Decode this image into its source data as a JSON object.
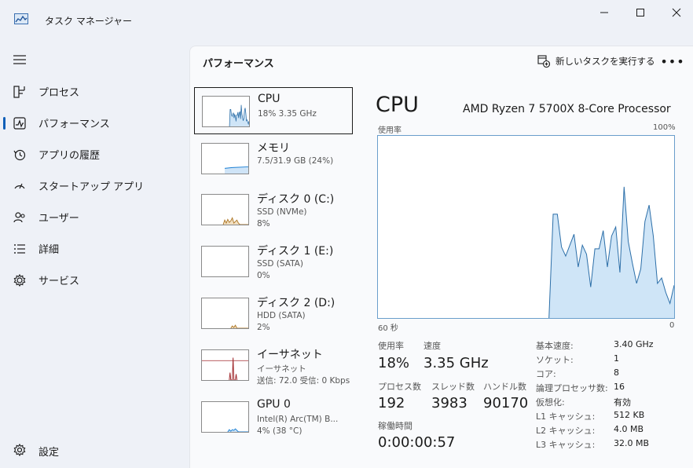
{
  "window": {
    "title": "タスク マネージャー",
    "controls": {
      "minimize": "minimize-icon",
      "maximize": "maximize-icon",
      "close": "close-icon"
    }
  },
  "nav": {
    "items": [
      {
        "label": "プロセス",
        "icon": "processes-icon"
      },
      {
        "label": "パフォーマンス",
        "icon": "performance-icon",
        "active": true
      },
      {
        "label": "アプリの履歴",
        "icon": "history-icon"
      },
      {
        "label": "スタートアップ アプリ",
        "icon": "startup-icon"
      },
      {
        "label": "ユーザー",
        "icon": "users-icon"
      },
      {
        "label": "詳細",
        "icon": "details-icon"
      },
      {
        "label": "サービス",
        "icon": "services-icon"
      }
    ],
    "settings": {
      "label": "設定",
      "icon": "gear-icon"
    }
  },
  "page": {
    "title": "パフォーマンス",
    "run_task_label": "新しいタスクを実行する",
    "more_label": "•••"
  },
  "devices": [
    {
      "name": "CPU",
      "sub1": "18%  3.35 GHz",
      "sub2": "",
      "color": "#1a7fd4",
      "selected": true
    },
    {
      "name": "メモリ",
      "sub1": "7.5/31.9 GB (24%)",
      "sub2": "",
      "color": "#1a7fd4"
    },
    {
      "name": "ディスク 0 (C:)",
      "sub1": "SSD (NVMe)",
      "sub2": "8%",
      "color": "#b07a2a"
    },
    {
      "name": "ディスク 1 (E:)",
      "sub1": "SSD (SATA)",
      "sub2": "0%",
      "color": "#b07a2a"
    },
    {
      "name": "ディスク 2 (D:)",
      "sub1": "HDD (SATA)",
      "sub2": "2%",
      "color": "#b07a2a"
    },
    {
      "name": "イーサネット",
      "sub1": "イーサネット",
      "sub2": "送信: 72.0  受信: 0 Kbps",
      "color": "#a0282c"
    },
    {
      "name": "GPU 0",
      "sub1": "Intel(R) Arc(TM) B...",
      "sub2": "4% (38 °C)",
      "color": "#1a7fd4"
    }
  ],
  "cpu": {
    "heading": "CPU",
    "model": "AMD Ryzen 7 5700X 8-Core Processor",
    "graph_label": "使用率",
    "graph_max": "100%",
    "graph_time": "60 秒",
    "graph_zero": "0",
    "utilization_series": [
      0,
      0,
      0,
      0,
      0,
      0,
      0,
      0,
      0,
      0,
      0,
      0,
      0,
      0,
      0,
      0,
      0,
      0,
      0,
      0,
      0,
      0,
      0,
      0,
      0,
      0,
      0,
      0,
      0,
      0,
      0,
      0,
      0,
      0,
      0,
      0,
      0,
      0,
      0,
      0,
      0,
      0,
      57,
      57,
      39,
      34,
      40,
      46,
      28,
      40,
      35,
      17,
      38,
      38,
      48,
      28,
      45,
      50,
      25,
      72,
      42,
      30,
      19,
      27,
      53,
      62,
      45,
      19,
      22,
      14,
      8,
      18
    ],
    "stats": {
      "utilization_label": "使用率",
      "utilization": "18%",
      "speed_label": "速度",
      "speed": "3.35 GHz",
      "processes_label": "プロセス数",
      "processes": "192",
      "threads_label": "スレッド数",
      "threads": "3983",
      "handles_label": "ハンドル数",
      "handles": "90170",
      "uptime_label": "稼働時間",
      "uptime": "0:00:00:57"
    },
    "specs": [
      {
        "k": "基本速度:",
        "v": "3.40 GHz"
      },
      {
        "k": "ソケット:",
        "v": "1"
      },
      {
        "k": "コア:",
        "v": "8"
      },
      {
        "k": "論理プロセッサ数:",
        "v": "16"
      },
      {
        "k": "仮想化:",
        "v": "有効"
      },
      {
        "k": "L1 キャッシュ:",
        "v": "512 KB"
      },
      {
        "k": "L2 キャッシュ:",
        "v": "4.0 MB"
      },
      {
        "k": "L3 キャッシュ:",
        "v": "32.0 MB"
      }
    ]
  }
}
